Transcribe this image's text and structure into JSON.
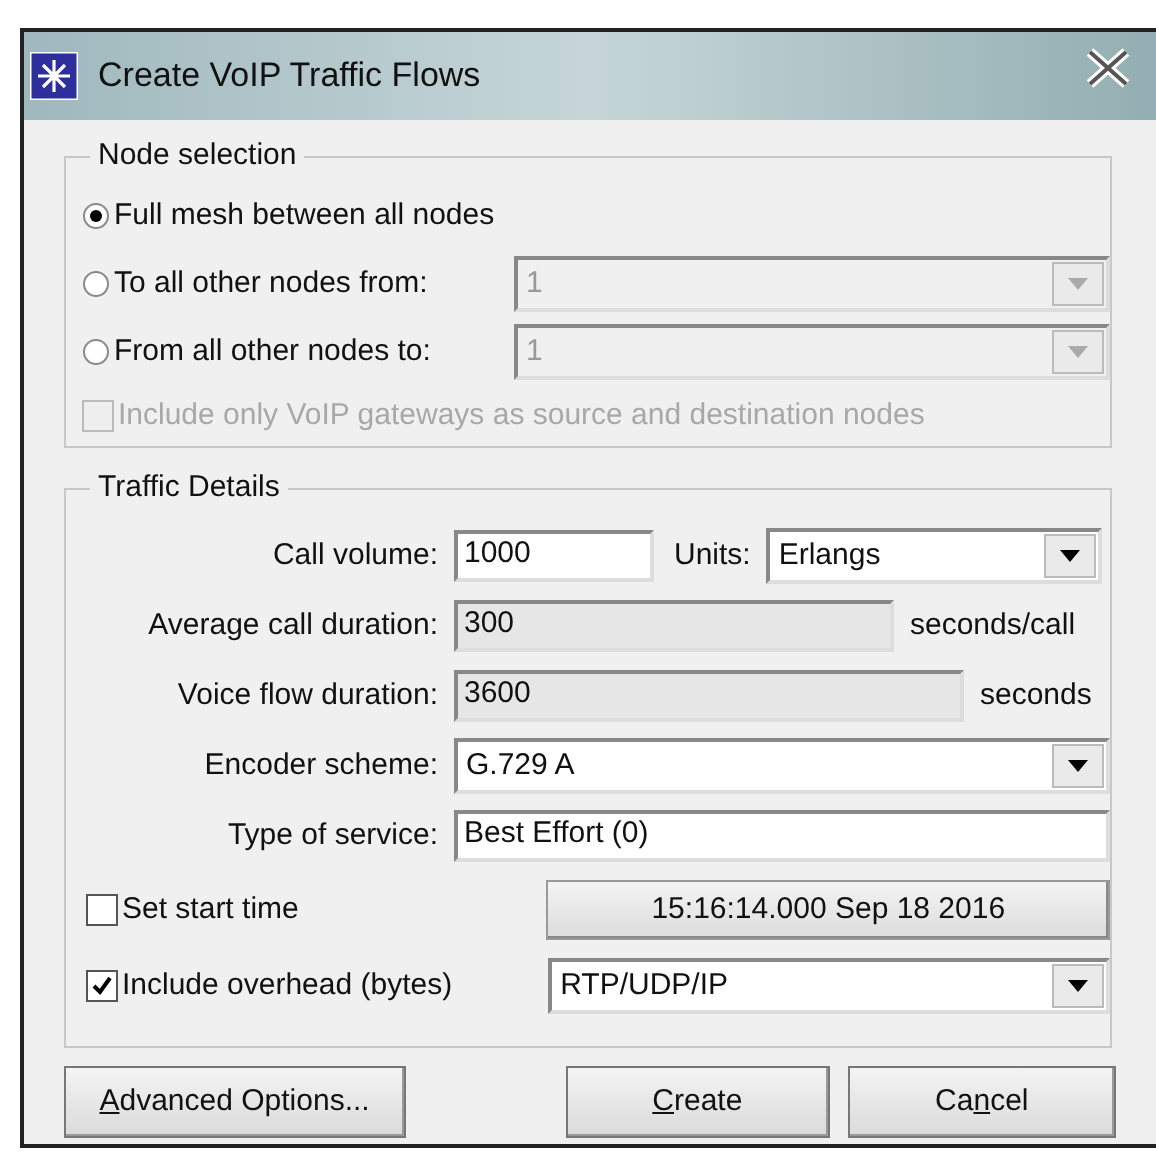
{
  "window": {
    "title": "Create VoIP Traffic Flows"
  },
  "node_selection": {
    "title": "Node selection",
    "options": [
      {
        "label": "Full mesh between all nodes",
        "selected": true
      },
      {
        "label": "To all other nodes from:",
        "selected": false,
        "combo": {
          "value": "1",
          "disabled": true
        }
      },
      {
        "label": "From all other nodes to:",
        "selected": false,
        "combo": {
          "value": "1",
          "disabled": true
        }
      }
    ],
    "gateways_only": {
      "label": "Include only VoIP gateways as source and destination nodes",
      "checked": false,
      "disabled": true
    }
  },
  "traffic_details": {
    "title": "Traffic Details",
    "call_volume": {
      "label": "Call volume:",
      "value": "1000"
    },
    "units": {
      "label": "Units:",
      "value": "Erlangs"
    },
    "average_call_duration": {
      "label": "Average call duration:",
      "value": "300",
      "unit": "seconds/call",
      "disabled": true
    },
    "voice_flow_duration": {
      "label": "Voice flow duration:",
      "value": "3600",
      "unit": "seconds",
      "disabled": true
    },
    "encoder_scheme": {
      "label": "Encoder scheme:",
      "value": "G.729 A"
    },
    "type_of_service": {
      "label": "Type of service:",
      "value": "Best Effort (0)"
    },
    "start_time": {
      "label": "Set start time",
      "checked": false,
      "button": "15:16:14.000 Sep 18 2016"
    },
    "overhead": {
      "label": "Include overhead (bytes)",
      "checked": true,
      "value": "RTP/UDP/IP"
    }
  },
  "buttons": [
    {
      "label": [
        {
          "text": "A",
          "underlined": true
        },
        {
          "text": "dvanced Options...",
          "underlined": false
        }
      ]
    },
    {
      "label": [
        {
          "text": "C",
          "underlined": true
        },
        {
          "text": "reate",
          "underlined": false
        }
      ]
    },
    {
      "label": [
        {
          "text": "Ca",
          "underlined": false
        },
        {
          "text": "n",
          "underlined": true
        },
        {
          "text": "cel",
          "underlined": false
        }
      ]
    }
  ]
}
